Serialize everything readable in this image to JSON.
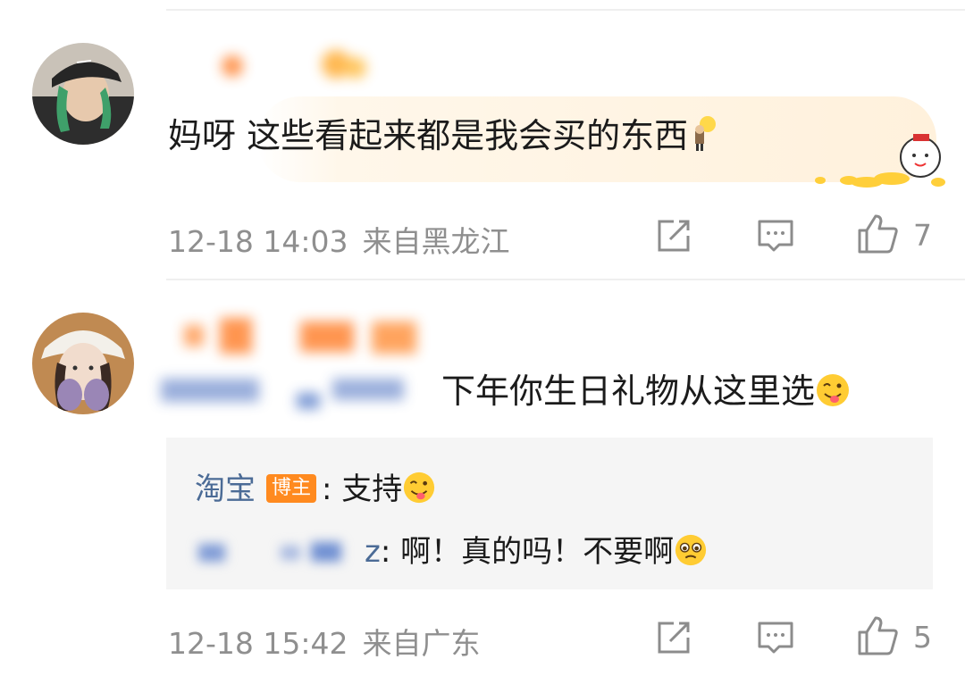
{
  "comments": [
    {
      "text": "妈呀 这些看起来都是我会买的东西",
      "emoji": "lightbulb-person-emoji",
      "time": "12-18 14:03",
      "location": "来自黑龙江",
      "likes": "7"
    },
    {
      "text": "下年你生日礼物从这里选",
      "emoji": "tongue-out-emoji",
      "time": "12-18 15:42",
      "location": "来自广东",
      "likes": "5",
      "replies": [
        {
          "author": "淘宝",
          "badge": "博主",
          "separator": ":",
          "text": "支持",
          "emoji": "tongue-out-emoji"
        },
        {
          "author_suffix": "z",
          "separator": ":",
          "text": "啊！真的吗！不要啊",
          "emoji": "pleading-emoji"
        }
      ]
    }
  ],
  "colors": {
    "meta_gray": "#8f8f8f",
    "reply_author_blue": "#4b6b96",
    "badge_orange": "#ff8a1f",
    "reply_bg": "#f5f5f5"
  }
}
